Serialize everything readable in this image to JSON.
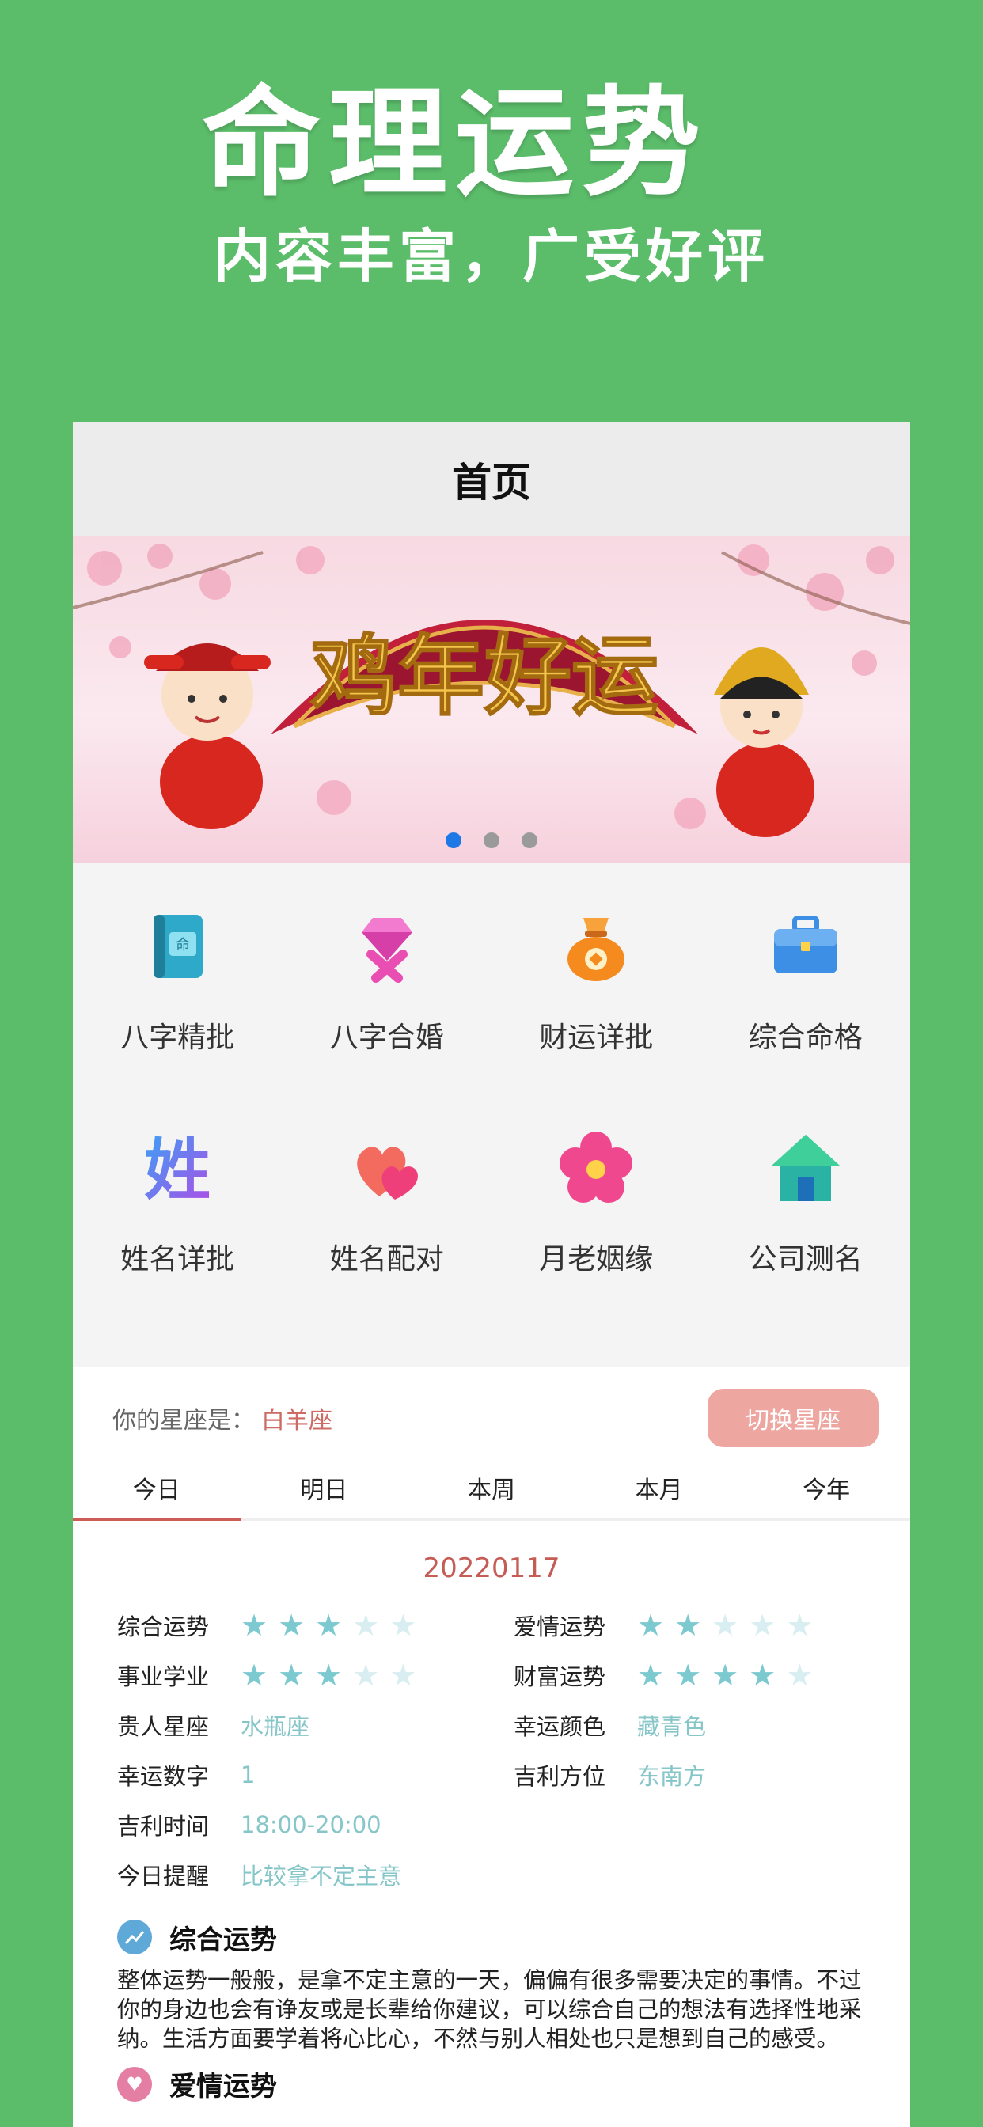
{
  "promo": {
    "title": "命理运势",
    "subtitle": "内容丰富，广受好评"
  },
  "navbar": {
    "title": "首页"
  },
  "banner": {
    "headline": "鸡年好运",
    "page_count": 3,
    "active_page": 1
  },
  "features": [
    {
      "label": "八字精批",
      "icon": "book-icon",
      "color": "#2fa9c9"
    },
    {
      "label": "八字合婚",
      "icon": "diamond-ribbon-icon",
      "color": "#e94fb2"
    },
    {
      "label": "财运详批",
      "icon": "money-bag-icon",
      "color": "#f58b1f"
    },
    {
      "label": "综合命格",
      "icon": "briefcase-icon",
      "color": "#3d8fe6"
    },
    {
      "label": "姓名详批",
      "icon": "name-glyph-icon",
      "color": "#8a48e6"
    },
    {
      "label": "姓名配对",
      "icon": "hearts-icon",
      "color": "#f0556a"
    },
    {
      "label": "月老姻缘",
      "icon": "flower-icon",
      "color": "#f0488f"
    },
    {
      "label": "公司测名",
      "icon": "house-icon",
      "color": "#2ab3a4"
    }
  ],
  "horoscope": {
    "sign_prefix": "你的星座是：",
    "sign_name": "白羊座",
    "switch_label": "切换星座",
    "tabs": [
      "今日",
      "明日",
      "本周",
      "本月",
      "今年"
    ],
    "active_tab": 0,
    "date": "20220117",
    "ratings": {
      "overall": {
        "label": "综合运势",
        "stars": 3,
        "max": 5
      },
      "love": {
        "label": "爱情运势",
        "stars": 2,
        "max": 5
      },
      "career": {
        "label": "事业学业",
        "stars": 3,
        "max": 5
      },
      "wealth": {
        "label": "财富运势",
        "stars": 4,
        "max": 5
      }
    },
    "info": {
      "noble_sign": {
        "label": "贵人星座",
        "value": "水瓶座"
      },
      "lucky_color": {
        "label": "幸运颜色",
        "value": "藏青色"
      },
      "lucky_number": {
        "label": "幸运数字",
        "value": "1"
      },
      "lucky_direction": {
        "label": "吉利方位",
        "value": "东南方"
      },
      "lucky_time": {
        "label": "吉利时间",
        "value": "18:00-20:00"
      },
      "today_tip": {
        "label": "今日提醒",
        "value": "比较拿不定主意"
      }
    },
    "section_overall": {
      "title": "综合运势",
      "body": "整体运势一般般，是拿不定主意的一天，偏偏有很多需要决定的事情。不过你的身边也会有诤友或是长辈给你建议，可以综合自己的想法有选择性地采纳。生活方面要学着将心比心，不然与别人相处也只是想到自己的感受。"
    },
    "section_love": {
      "title": "爱情运势"
    }
  },
  "colors": {
    "background": "#5bbd6a",
    "accent": "#c55d56",
    "star_on": "#7cc9d0",
    "star_off": "#d8eef0"
  }
}
